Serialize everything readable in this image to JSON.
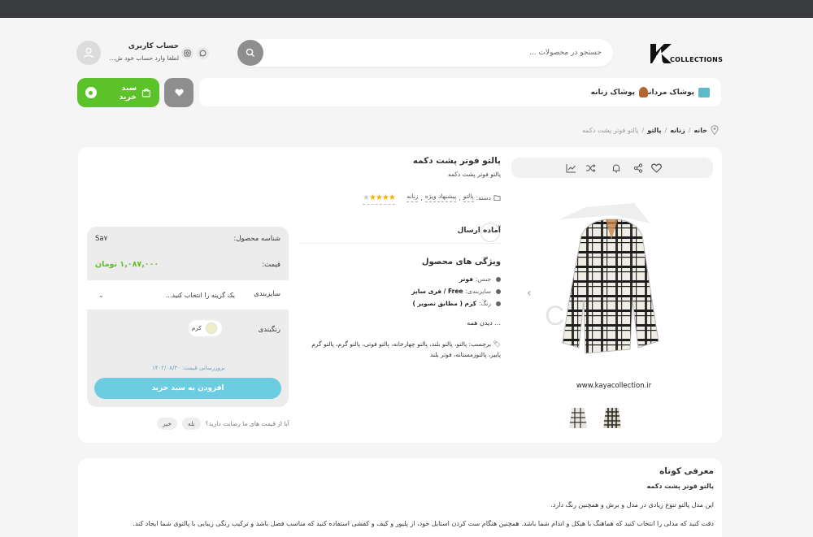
{
  "header": {
    "logo_text": "COLLECTIONS",
    "search_placeholder": "جستجو در محصولات ...",
    "account_title": "حساب کاربری",
    "account_subtitle": "لطفا وارد حساب خود ش..."
  },
  "nav": {
    "items": [
      {
        "label": "پوشاک مردانه",
        "icon": "men-shirt-icon"
      },
      {
        "label": "پوشاک زنانه",
        "icon": "women-avatar-icon"
      }
    ],
    "cart_label": "سبد خرید"
  },
  "breadcrumb": {
    "items": [
      "خانه",
      "زنانه",
      "پالتو"
    ],
    "current": "پالتو فوتر پشت دکمه"
  },
  "product": {
    "title": "پالتو فوتر پشت دکمه",
    "subtitle": "پالتو فوتر پشت دکمه",
    "category_label": "دسته:",
    "categories": [
      "پالتو",
      "پیشنهاد ویژه",
      "زنانه"
    ],
    "rating": 4,
    "status": "آماده ارسال",
    "features_title": "ویژگی های محصول",
    "features": [
      {
        "key": "جنس:",
        "value": "فوتر"
      },
      {
        "key": "سایزبندی:",
        "value": "Free / فری سایز"
      },
      {
        "key": "رنگ:",
        "value": "کرم ( مطابق تصویر )"
      }
    ],
    "see_all": "... دیدن همه",
    "tags_label": "برچسب:",
    "tags": "پالتو، پالتو بلند، پالتو چهارخانه، پالتو فوتی، پالتو گرم، پالتو گرم پاییز، پالتوزمستانه، فوتر بلند",
    "website": "www.kayacollection.ir",
    "image_watermark": "C"
  },
  "buybox": {
    "sku_label": "شناسه محصول:",
    "sku": "Sa۷",
    "price_label": "قیمت:",
    "price": "۱,۰۸۷,۰۰۰ تومان",
    "size_label": "سایزبندی",
    "size_placeholder": "یک گزینه را انتخاب کنید...",
    "color_label": "رنگبندی",
    "color_option": "کرم",
    "updated": "بروزرسانی قیمت: ۱۴۰۲/۰۸/۳۰",
    "add_to_cart": "افزودن به سبد خرید"
  },
  "satisfaction": {
    "question": "آیا از قیمت های ما رضایت دارید؟",
    "yes": "بله",
    "no": "خیر"
  },
  "description": {
    "title": "معرفی کوتاه",
    "subtitle": "پالتو فوتر پشت دکمه",
    "p1": "این مدل پالتو تنوع زیادی در مدل و برش و همچنین رنگ دارد.",
    "p2": "دقت کنید که مدلی را انتخاب کنید که هماهنگ با هیکل و اندام شما باشد. همچنین هنگام ست کردن استایل خود، از پلیور و کیف و کفشی استفاده کنید که مناسب فصل باشد و ترکیب رنگی زیبایی با پالتوی شما ایجاد کند."
  },
  "colors": {
    "green": "#5cc22a",
    "cyan": "#6ccde0",
    "gray_button": "#8e8e8e",
    "topbar": "#3a3b3f"
  }
}
